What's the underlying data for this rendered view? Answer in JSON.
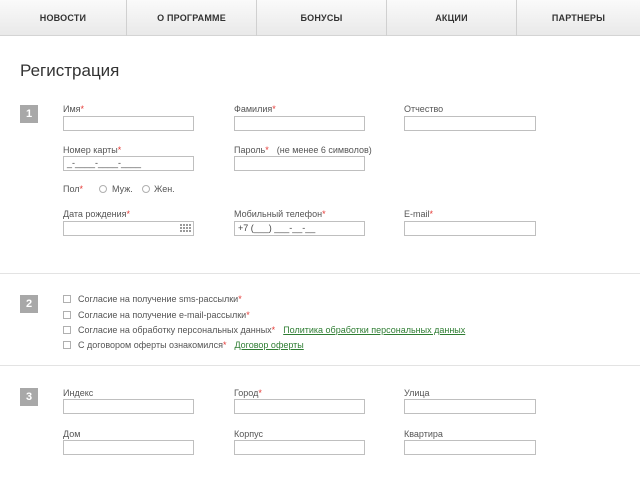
{
  "nav": {
    "items": [
      {
        "label": "НОВОСТИ"
      },
      {
        "label": "О ПРОГРАММЕ"
      },
      {
        "label": "БОНУСЫ"
      },
      {
        "label": "АКЦИИ"
      },
      {
        "label": "ПАРТНЕРЫ"
      }
    ]
  },
  "page_title": "Регистрация",
  "required_mark": "*",
  "sections": {
    "personal": {
      "step": "1",
      "first_name_label": "Имя",
      "last_name_label": "Фамилия",
      "patronymic_label": "Отчество",
      "card_number_label": "Номер карты",
      "card_number_value": "_-____-____-____",
      "password_label": "Пароль",
      "password_hint": "(не менее 6 символов)",
      "gender_label": "Пол",
      "gender_male": "Муж.",
      "gender_female": "Жен.",
      "birth_date_label": "Дата рождения",
      "mobile_label": "Мобильный телефон",
      "mobile_value": "+7 (___) ___-__-__",
      "email_label": "E-mail"
    },
    "consents": {
      "step": "2",
      "sms": "Согласие на получение sms-рассылки",
      "email": "Согласие на получение e-mail-рассылки",
      "personal_data": "Согласие на обработку персональных данных",
      "personal_data_link": "Политика обработки персональных данных",
      "offer": "С договором оферты ознакомился",
      "offer_link": "Договор оферты"
    },
    "address": {
      "step": "3",
      "index_label": "Индекс",
      "city_label": "Город",
      "street_label": "Улица",
      "house_label": "Дом",
      "building_label": "Корпус",
      "apartment_label": "Квартира"
    }
  }
}
